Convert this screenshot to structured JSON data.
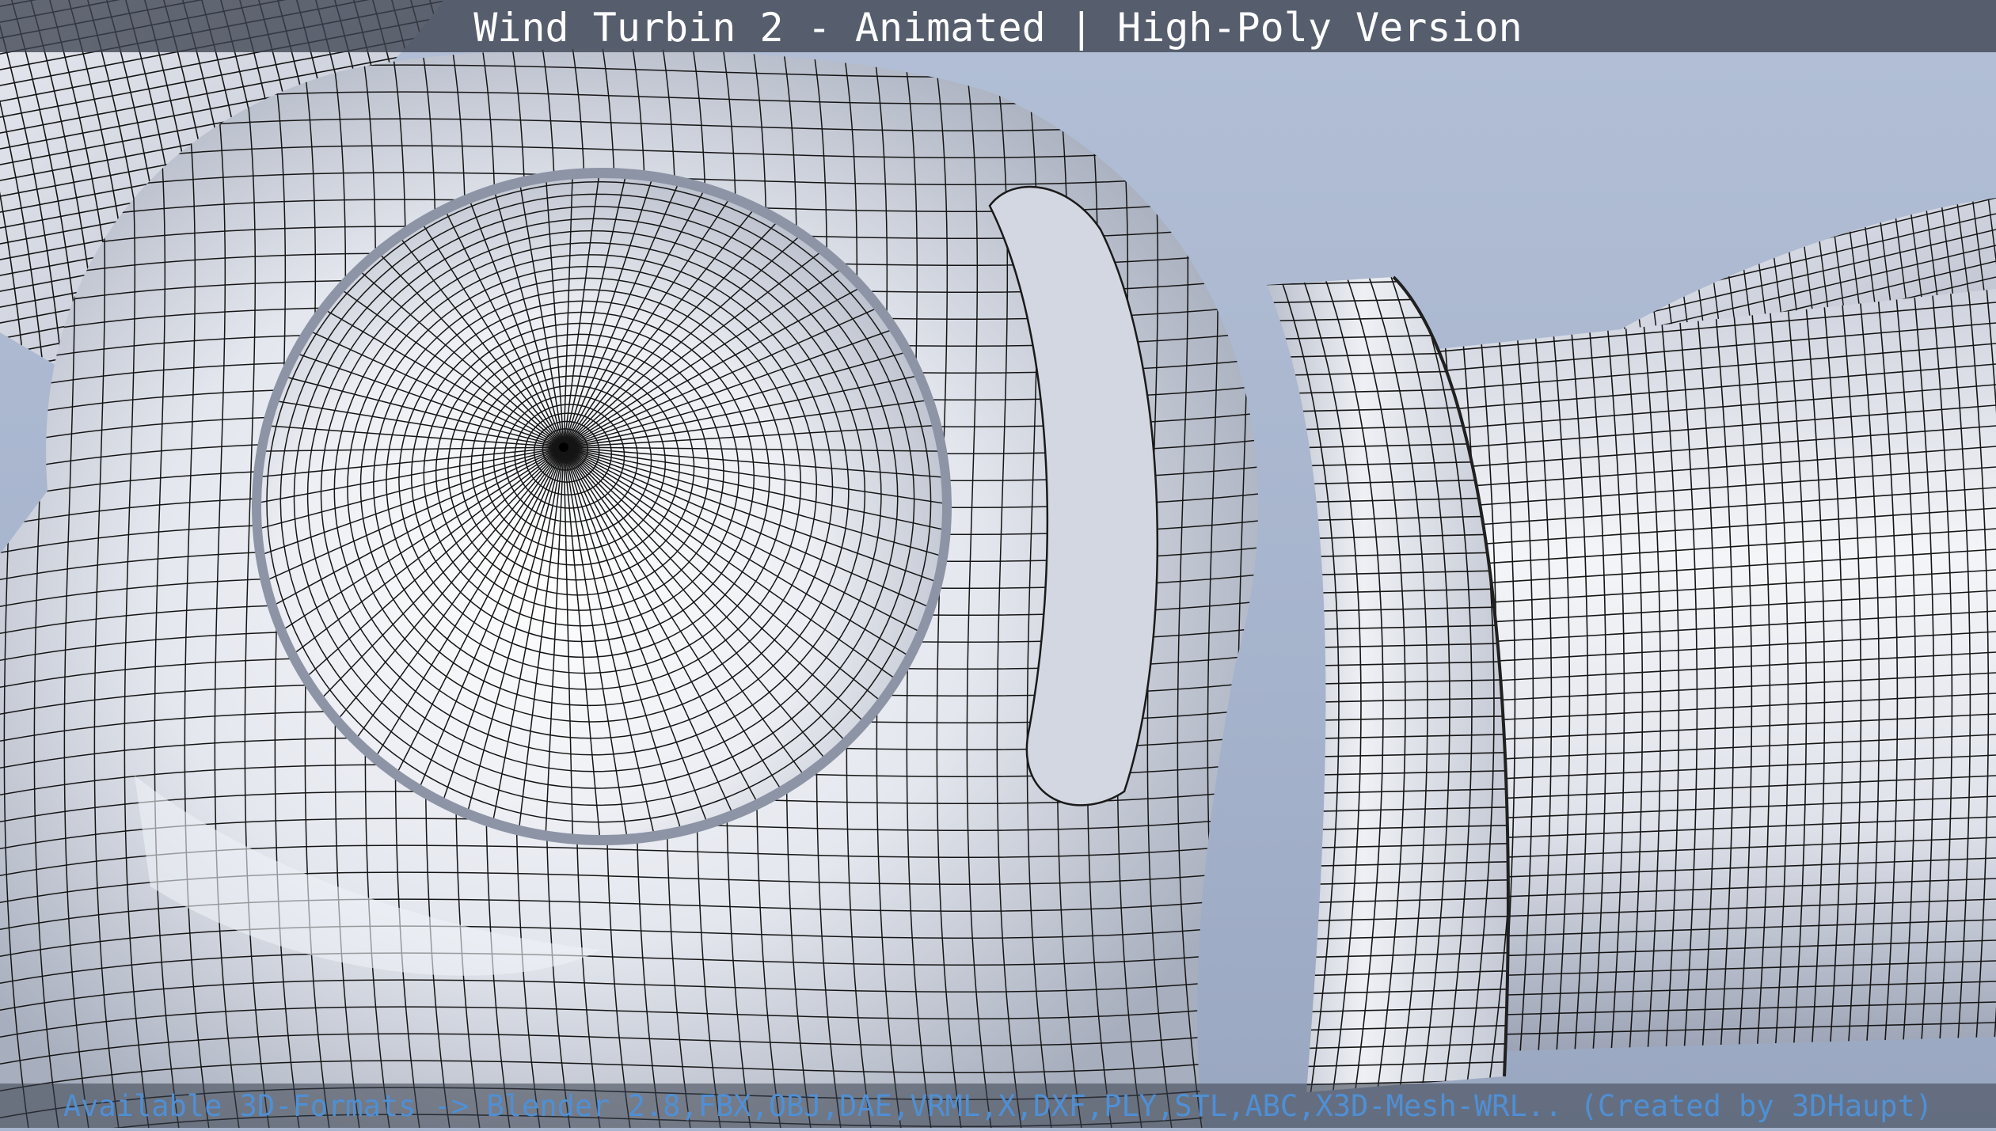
{
  "header": {
    "title": "Wind Turbin 2 - Animated | High-Poly Version"
  },
  "footer": {
    "formats_text": "Available 3D-Formats -> Blender 2.8,FBX,OBJ,DAE,VRML,X,DXF,PLY,STL,ABC,X3D-Mesh-WRL.. (Created by 3DHaupt)"
  },
  "viewport": {
    "content": "wireframe-render",
    "colors": {
      "sky": "#a9b6cf",
      "mesh_surface": "#e9ebf1",
      "mesh_shadow": "#8e96a8",
      "wire": "#111111",
      "footer_text": "#4f8fd4"
    }
  }
}
